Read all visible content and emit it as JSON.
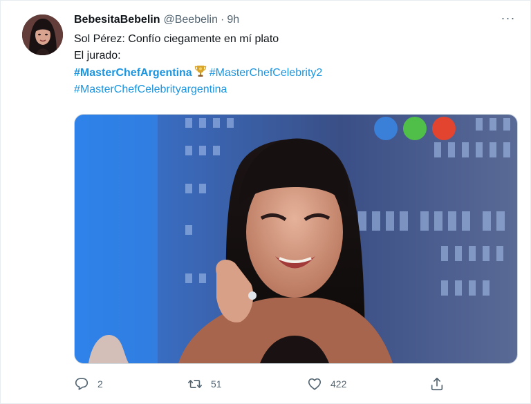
{
  "tweet": {
    "display_name": "BebesitaBebelin",
    "handle": "@Beebelin",
    "separator": "·",
    "time": "9h",
    "more_label": "···",
    "line1": "Sol Pérez: Confío ciegamente en mí plato",
    "line2": "El jurado:",
    "hashtags": [
      "#MasterChefArgentina",
      "#MasterChefCelebrity2",
      "#MasterChefCelebrityargentina"
    ]
  },
  "actions": {
    "replies": "2",
    "retweets": "51",
    "likes": "422"
  },
  "colors": {
    "link": "#1b95e0",
    "secondary_text": "#536471",
    "primary_text": "#0f1419",
    "border": "#cfd9de"
  },
  "icons": {
    "reply": "speech-bubble-icon",
    "retweet": "retweet-arrows-icon",
    "like": "heart-icon",
    "share": "upload-share-icon",
    "more": "ellipsis-icon",
    "badge": "trophy-icon"
  }
}
